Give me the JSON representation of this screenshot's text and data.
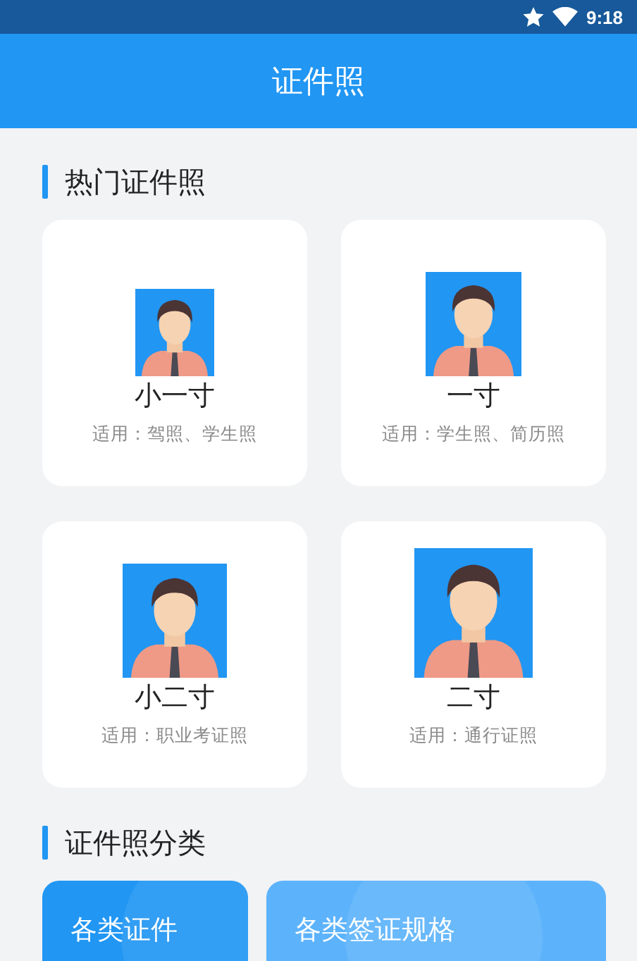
{
  "status_bar": {
    "time": "9:18"
  },
  "app_bar": {
    "title": "证件照"
  },
  "sections": [
    {
      "title": "热门证件照"
    },
    {
      "title": "证件照分类"
    }
  ],
  "photo_sizes": [
    {
      "kind": "small-one",
      "name": "小一寸",
      "usage": "适用：驾照、学生照"
    },
    {
      "kind": "one",
      "name": "一寸",
      "usage": "适用：学生照、简历照"
    },
    {
      "kind": "small-two",
      "name": "小二寸",
      "usage": "适用：职业考证照"
    },
    {
      "kind": "two",
      "name": "二寸",
      "usage": "适用：通行证照"
    }
  ],
  "categories": [
    {
      "kind": "dark",
      "title": "各类证件"
    },
    {
      "kind": "light",
      "title": "各类签证规格"
    }
  ]
}
